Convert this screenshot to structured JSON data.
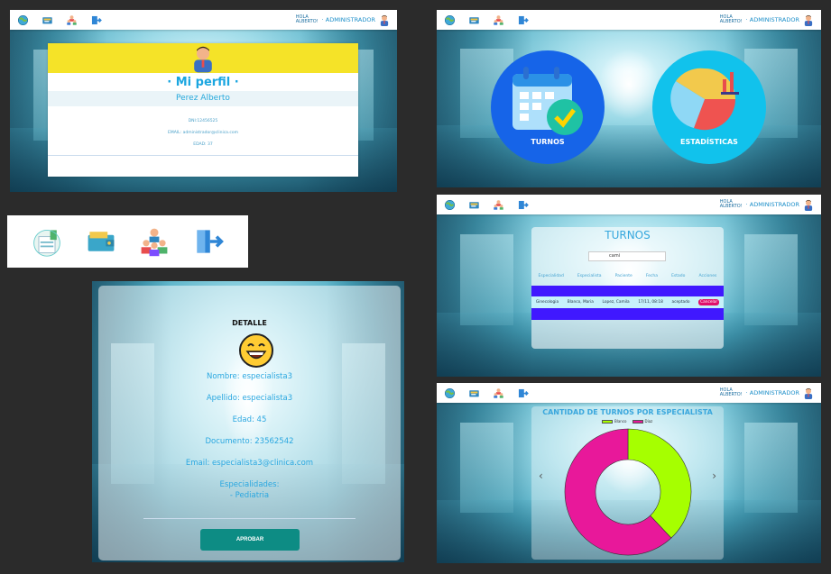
{
  "colors": {
    "accent": "#1aa6e0",
    "yellow": "#f5e328",
    "teal": "#0d8c84",
    "chart_green": "#a6ff00",
    "chart_pink": "#e8189a",
    "row_blue": "#4018ff"
  },
  "navbar": {
    "hola": "HOLA",
    "user": "ALBERTO!",
    "role": "· ADMINISTRADOR",
    "icons": [
      "globe-icon",
      "ticket-icon",
      "users-icon",
      "logout-icon"
    ]
  },
  "profile": {
    "title": "· Mi perfil ·",
    "name": "Perez Alberto",
    "dni": "DNI:12456525",
    "email": "EMAIL: administrador@clinica.com",
    "edad": "EDAD: 37"
  },
  "home": {
    "turnos_label": "TURNOS",
    "estadisticas_label": "ESTADÍSTICAS"
  },
  "turnos": {
    "title": "TURNOS",
    "search_value": "cami",
    "columns": [
      "Especialidad",
      "Especialista",
      "Paciente",
      "Fecha",
      "Estado",
      "Acciones"
    ],
    "row": {
      "especialidad": "Ginecologia",
      "especialista": "Blanco, Maria",
      "paciente": "Lopez, Camila",
      "fecha": "17/11, 08:18",
      "estado": "aceptado",
      "accion": "Cancelar"
    }
  },
  "chart": {
    "title": "CANTIDAD DE TURNOS POR ESPECIALISTA"
  },
  "chart_data": {
    "type": "pie",
    "title": "CANTIDAD DE TURNOS POR ESPECIALISTA",
    "series": [
      {
        "name": "Blanco",
        "value": 38
      },
      {
        "name": "Diaz",
        "value": 62
      }
    ],
    "legend": "top"
  },
  "detail": {
    "title": "DETALLE",
    "nombre": "Nombre: especialista3",
    "apellido": "Apellido: especialista3",
    "edad": "Edad: 45",
    "documento": "Documento: 23562542",
    "email": "Email: especialista3@clinica.com",
    "especialidades": "Especialidades:",
    "especialidad_item": "- Pediatria",
    "button": "APROBAR"
  }
}
